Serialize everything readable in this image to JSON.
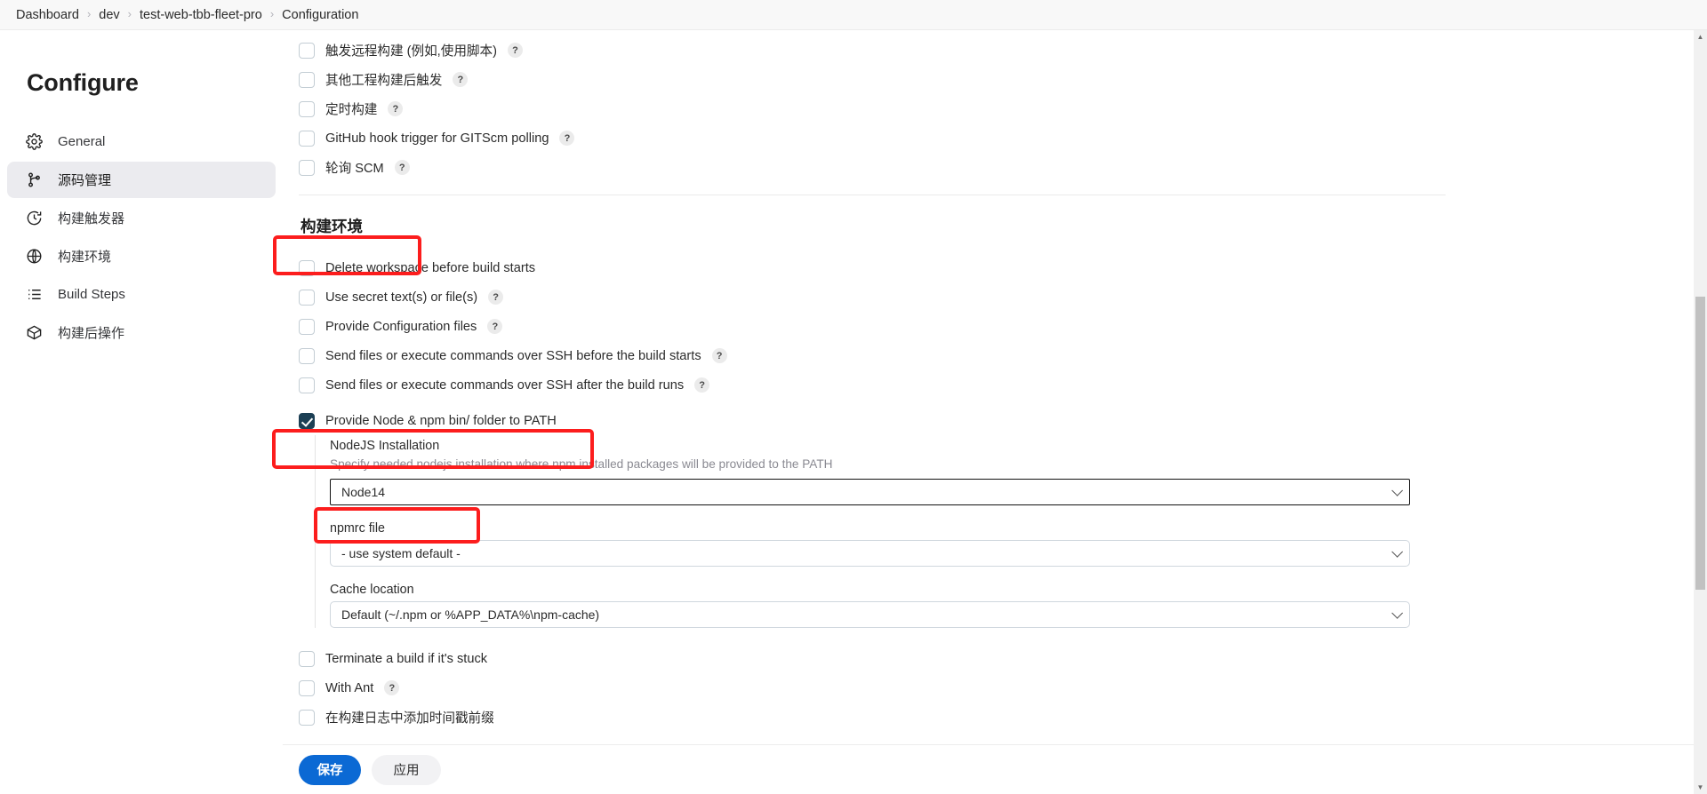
{
  "breadcrumb": {
    "separator": "›",
    "items": [
      {
        "label": "Dashboard"
      },
      {
        "label": "dev"
      },
      {
        "label": "test-web-tbb-fleet-pro"
      },
      {
        "label": "Configuration"
      }
    ]
  },
  "sidebar": {
    "title": "Configure",
    "items": [
      {
        "label": "General",
        "icon": "gear-icon",
        "selected": false
      },
      {
        "label": "源码管理",
        "icon": "source-branch-icon",
        "selected": true
      },
      {
        "label": "构建触发器",
        "icon": "clock-icon",
        "selected": false
      },
      {
        "label": "构建环境",
        "icon": "globe-icon",
        "selected": false
      },
      {
        "label": "Build Steps",
        "icon": "list-icon",
        "selected": false
      },
      {
        "label": "构建后操作",
        "icon": "package-icon",
        "selected": false
      }
    ]
  },
  "triggers": {
    "rows": [
      {
        "label": "触发远程构建 (例如,使用脚本)",
        "help": "?",
        "checked": false
      },
      {
        "label": "其他工程构建后触发",
        "help": "?",
        "checked": false
      },
      {
        "label": "定时构建",
        "help": "?",
        "checked": false
      },
      {
        "label": "GitHub hook trigger for GITScm polling",
        "help": "?",
        "checked": false
      },
      {
        "label": "轮询 SCM",
        "help": "?",
        "checked": false
      }
    ]
  },
  "build_environment": {
    "heading": "构建环境",
    "rows_before": [
      {
        "label": "Delete workspace before build starts",
        "help": "",
        "checked": false
      },
      {
        "label": "Use secret text(s) or file(s)",
        "help": "?",
        "checked": false
      },
      {
        "label": "Provide Configuration files",
        "help": "?",
        "checked": false
      },
      {
        "label": "Send files or execute commands over SSH before the build starts",
        "help": "?",
        "checked": false
      },
      {
        "label": "Send files or execute commands over SSH after the build runs",
        "help": "?",
        "checked": false
      }
    ],
    "node_row": {
      "label": "Provide Node & npm bin/ folder to PATH",
      "checked": true
    },
    "nodejs": {
      "installation_label": "NodeJS Installation",
      "installation_desc": "Specify needed nodejs installation where npm installed packages will be provided to the PATH",
      "installation_value": "Node14",
      "npmrc_label": "npmrc file",
      "npmrc_value": "- use system default -",
      "cache_label": "Cache location",
      "cache_value": "Default (~/.npm or %APP_DATA%\\npm-cache)"
    },
    "rows_after": [
      {
        "label": "Terminate a build if it's stuck",
        "help": "",
        "checked": false
      },
      {
        "label": "With Ant",
        "help": "?",
        "checked": false
      },
      {
        "label": "在构建日志中添加时间戳前缀",
        "help": "",
        "checked": false
      }
    ]
  },
  "actions": {
    "save_label": "保存",
    "apply_label": "应用"
  },
  "colors": {
    "primary_button": "#0b69d4",
    "checkbox_checked": "#1c3f54",
    "annotation": "#fc1d1d",
    "sidebar_selected": "#ebebef"
  }
}
